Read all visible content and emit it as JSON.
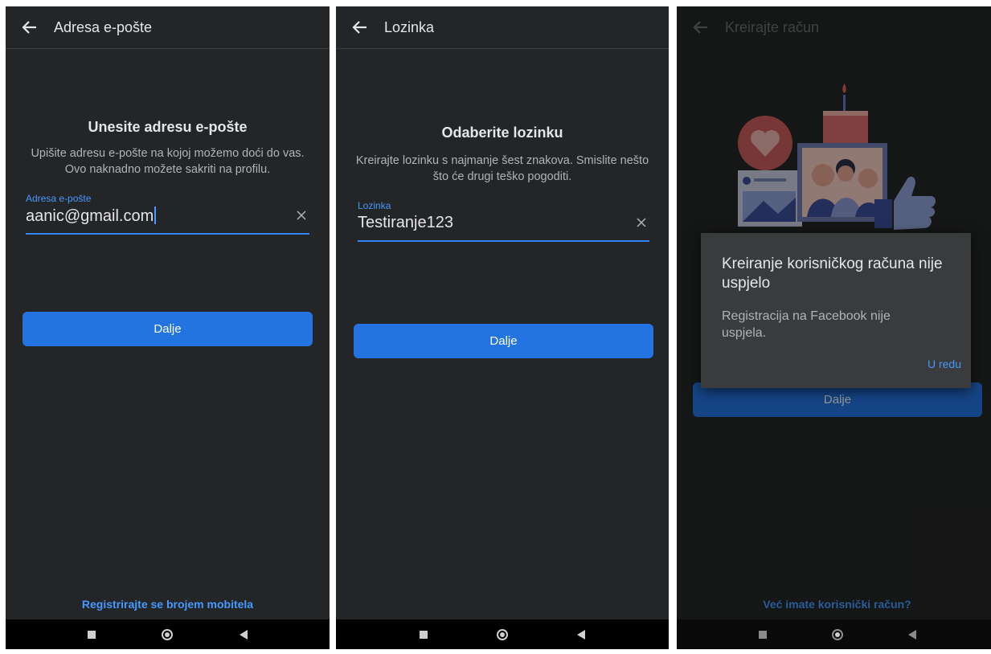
{
  "screen1": {
    "header_title": "Adresa e-pošte",
    "heading": "Unesite adresu e-pošte",
    "description": "Upišite adresu e-pošte na kojoj možemo doći do vas. Ovo naknadno možete sakriti na profilu.",
    "field_label": "Adresa e-pošte",
    "field_value": "aanic@gmail.com",
    "next_button": "Dalje",
    "bottom_link": "Registrirajte se brojem mobitela"
  },
  "screen2": {
    "header_title": "Lozinka",
    "heading": "Odaberite lozinku",
    "description": "Kreirajte lozinku s najmanje šest znakova. Smislite nešto što će drugi teško pogoditi.",
    "field_label": "Lozinka",
    "field_value": "Testiranje123",
    "next_button": "Dalje"
  },
  "screen3": {
    "header_title": "Kreirajte račun",
    "next_button": "Dalje",
    "bottom_link": "Već imate korisnički račun?",
    "dialog": {
      "title": "Kreiranje korisničkog računa nije uspjelo",
      "message": "Registracija na Facebook nije uspjela.",
      "ok_button": "U redu"
    }
  },
  "icons": {
    "back": "back-arrow-icon",
    "clear": "close-icon",
    "nav_recents": "square-icon",
    "nav_home": "circle-icon",
    "nav_back": "triangle-back-icon"
  },
  "colors": {
    "background": "#242526",
    "primary_button": "#2374e1",
    "link": "#4599ff",
    "text": "#e4e6eb",
    "secondary_text": "#b0b3b8"
  }
}
